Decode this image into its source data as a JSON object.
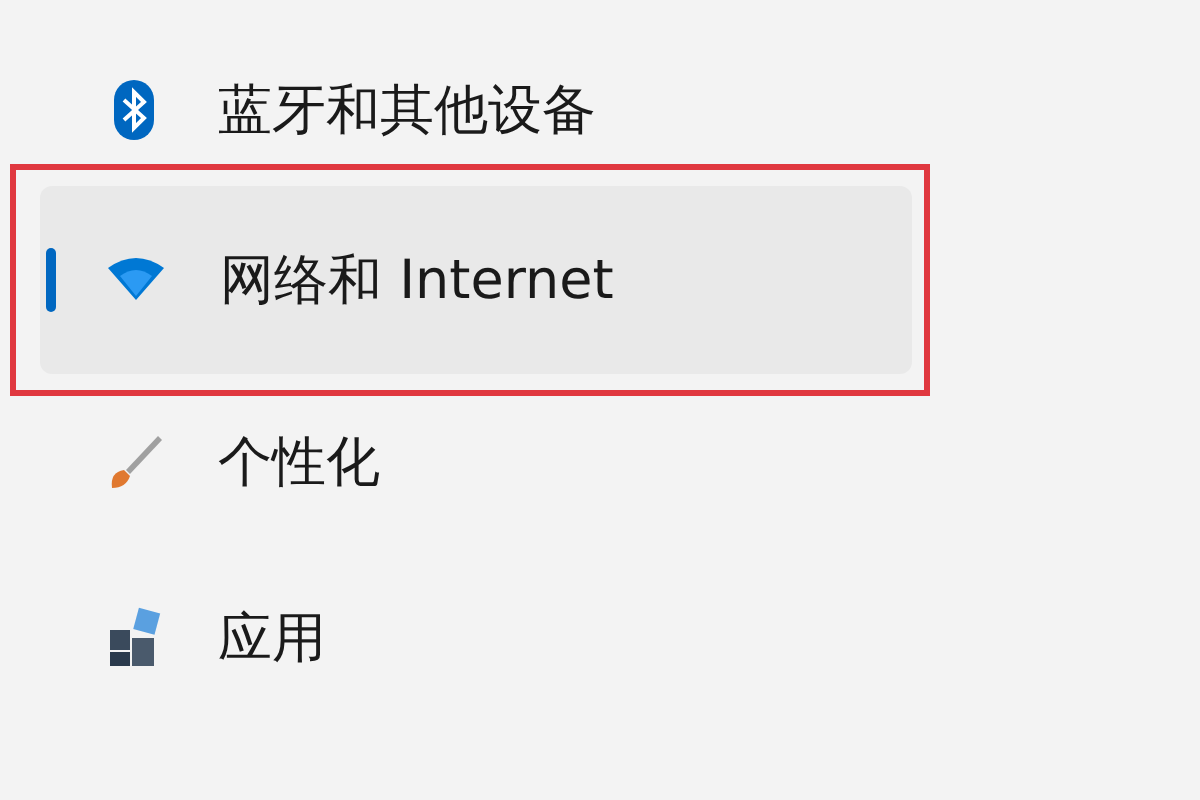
{
  "sidebar": {
    "items": [
      {
        "kind": "bluetooth",
        "label": "蓝牙和其他设备",
        "selected": false,
        "annotated": false
      },
      {
        "kind": "network",
        "label": "网络和 Internet",
        "selected": true,
        "annotated": true
      },
      {
        "kind": "personalization",
        "label": "个性化",
        "selected": false,
        "annotated": false
      },
      {
        "kind": "apps",
        "label": "应用",
        "selected": false,
        "annotated": false
      }
    ]
  }
}
